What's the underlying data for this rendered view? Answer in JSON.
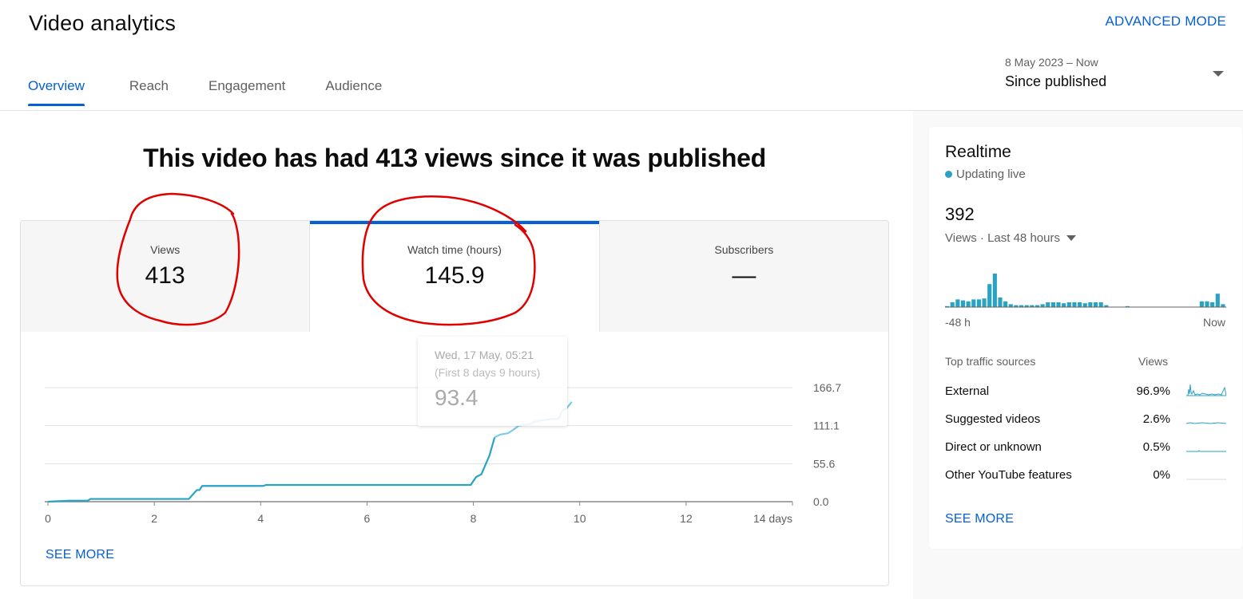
{
  "header": {
    "title": "Video analytics",
    "advanced_mode": "ADVANCED MODE",
    "tabs": [
      {
        "label": "Overview",
        "active": true
      },
      {
        "label": "Reach",
        "active": false
      },
      {
        "label": "Engagement",
        "active": false
      },
      {
        "label": "Audience",
        "active": false
      }
    ],
    "date_range": {
      "sub": "8 May 2023 – Now",
      "label": "Since published"
    }
  },
  "headline": "This video has had 413 views since it was published",
  "metrics": [
    {
      "label": "Views",
      "value": "413"
    },
    {
      "label": "Watch time (hours)",
      "value": "145.9",
      "selected": true
    },
    {
      "label": "Subscribers",
      "value": "—"
    }
  ],
  "tooltip": {
    "date": "Wed, 17 May, 05:21",
    "period": "(First 8 days 9 hours)",
    "value": "93.4"
  },
  "chart_data": {
    "type": "line",
    "series": [
      {
        "values": [
          [
            0,
            0.0
          ],
          [
            0.4,
            1.5
          ],
          [
            0.75,
            1.5
          ],
          [
            0.8,
            4.0
          ],
          [
            2.65,
            4.0
          ],
          [
            2.8,
            17.0
          ],
          [
            2.85,
            17.0
          ],
          [
            2.9,
            23.0
          ],
          [
            4.05,
            23.0
          ],
          [
            4.1,
            24.5
          ],
          [
            7.95,
            24.5
          ],
          [
            8.05,
            36.0
          ],
          [
            8.15,
            40.0
          ],
          [
            8.3,
            67.0
          ],
          [
            8.4,
            94.0
          ],
          [
            8.5,
            98.0
          ],
          [
            8.65,
            100.0
          ],
          [
            8.75,
            105.0
          ],
          [
            8.85,
            111.0
          ],
          [
            9.05,
            113.0
          ],
          [
            9.2,
            118.0
          ],
          [
            9.5,
            121.0
          ],
          [
            9.6,
            121.0
          ],
          [
            9.68,
            134.0
          ],
          [
            9.75,
            136.0
          ],
          [
            9.85,
            145.9
          ]
        ]
      }
    ],
    "highlight_range": [
      8.4,
      9.85
    ],
    "x_ticks": [
      "0",
      "2",
      "4",
      "6",
      "8",
      "10",
      "12",
      "14 days"
    ],
    "x_range": [
      0,
      14
    ],
    "y_ticks": [
      "0.0",
      "55.6",
      "111.1",
      "166.7"
    ],
    "y_range": [
      0,
      166.7
    ],
    "grid": true,
    "color": "#29a2c4",
    "highlight_color": "#7ecbe5"
  },
  "see_more": "SEE MORE",
  "realtime": {
    "title": "Realtime",
    "status": "Updating live",
    "count": "392",
    "views_label": "Views · Last 48 hours",
    "bar_chart": {
      "type": "bar",
      "values": [
        1,
        5,
        8,
        7,
        6,
        8,
        8,
        9,
        24,
        35,
        10,
        6,
        3,
        2,
        2,
        2,
        2,
        2,
        3,
        5,
        5,
        5,
        4,
        5,
        5,
        5,
        4,
        5,
        5,
        5,
        2,
        0,
        0,
        0,
        1,
        0,
        0,
        0,
        0,
        0,
        0,
        0,
        0,
        0,
        0,
        0,
        0,
        0,
        6,
        6,
        5,
        14,
        3
      ],
      "color": "#29a2c4"
    },
    "x_start": "-48 h",
    "x_end": "Now",
    "traffic_header": "Top traffic sources",
    "traffic_views_header": "Views",
    "sources": [
      {
        "name": "External",
        "pct": "96.9%"
      },
      {
        "name": "Suggested videos",
        "pct": "2.6%"
      },
      {
        "name": "Direct or unknown",
        "pct": "0.5%"
      },
      {
        "name": "Other YouTube features",
        "pct": "0%"
      }
    ],
    "see_more": "SEE MORE"
  },
  "colors": {
    "accent": "#065fd4",
    "series": "#29a2c4",
    "annotation": "#e00000"
  }
}
